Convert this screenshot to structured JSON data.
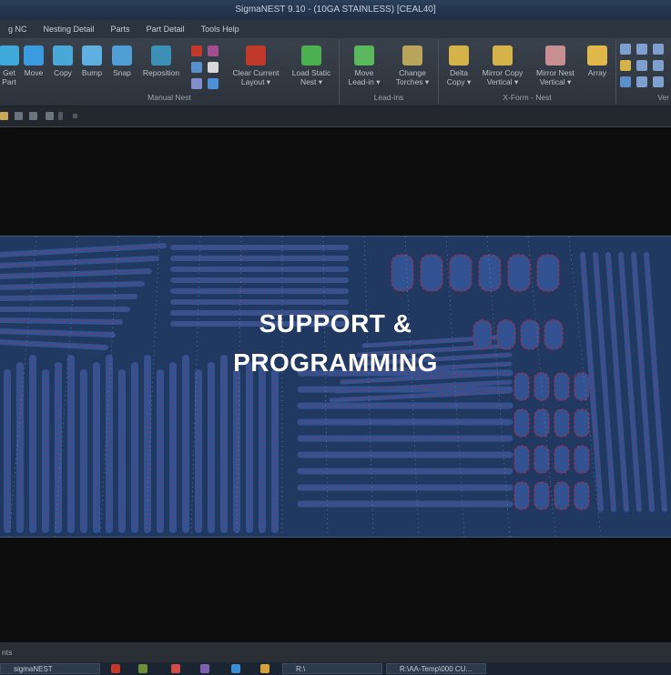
{
  "window": {
    "title": "SigmaNEST 9.10 -    (10GA STAINLESS) [CEAL40]"
  },
  "menu": [
    "g NC",
    "Nesting Detail",
    "Parts",
    "Part Detail",
    "Tools Help"
  ],
  "ribbon": {
    "manual_nest": {
      "label": "Manual Nest",
      "buttons": [
        {
          "l1": "Get",
          "l2": "Part",
          "icon": "get-part-icon",
          "color": "#3fa9d9"
        },
        {
          "l1": "Move",
          "l2": "",
          "icon": "move-icon",
          "color": "#3b9be0"
        },
        {
          "l1": "Copy",
          "l2": "",
          "icon": "copy-icon",
          "color": "#4aa8d8"
        },
        {
          "l1": "Bump",
          "l2": "",
          "icon": "bump-icon",
          "color": "#5fb0e0"
        },
        {
          "l1": "Snap",
          "l2": "",
          "icon": "snap-icon",
          "color": "#4f9fd6"
        },
        {
          "l1": "Reposition",
          "l2": "",
          "icon": "reposition-icon",
          "color": "#3c8fb5"
        },
        {
          "l1": "Clear Current",
          "l2": "Layout ▾",
          "icon": "clear-layout-icon",
          "color": "#c0392b"
        },
        {
          "l1": "Load Static",
          "l2": "Nest ▾",
          "icon": "load-static-nest-icon",
          "color": "#4caf50"
        }
      ]
    },
    "lead_ins": {
      "label": "Lead-ins",
      "buttons": [
        {
          "l1": "Move",
          "l2": "Lead-in ▾",
          "icon": "move-lead-in-icon",
          "color": "#5cb85c"
        },
        {
          "l1": "Change",
          "l2": "Torches ▾",
          "icon": "change-torches-icon",
          "color": "#b8a45a"
        }
      ]
    },
    "xform_nest": {
      "label": "X-Form - Nest",
      "buttons": [
        {
          "l1": "Delta",
          "l2": "Copy ▾",
          "icon": "delta-copy-icon",
          "color": "#d6b24a"
        },
        {
          "l1": "Mirror Copy",
          "l2": "Vertical ▾",
          "icon": "mirror-copy-vertical-icon",
          "color": "#d6b24a"
        },
        {
          "l1": "Mirror Nest",
          "l2": "Vertical ▾",
          "icon": "mirror-nest-vertical-icon",
          "color": "#c78f8f"
        },
        {
          "l1": "Array",
          "l2": "",
          "icon": "array-icon",
          "color": "#e0b84a"
        }
      ]
    },
    "vertex": {
      "label": "Ver"
    }
  },
  "overlay": {
    "line1": "SUPPORT &",
    "line2": "PROGRAMMING"
  },
  "status": {
    "text": "nts"
  },
  "taskbar": {
    "items": [
      {
        "label": "sigmaNEST"
      },
      {
        "label": "R:\\"
      },
      {
        "label": "R:\\AA-Temp\\000 CU..."
      }
    ]
  },
  "colors": {
    "accent": "#3b5d8f",
    "nest_bg": "#26406b",
    "part": "#3b5ea8",
    "part_edge": "#c0314a"
  }
}
